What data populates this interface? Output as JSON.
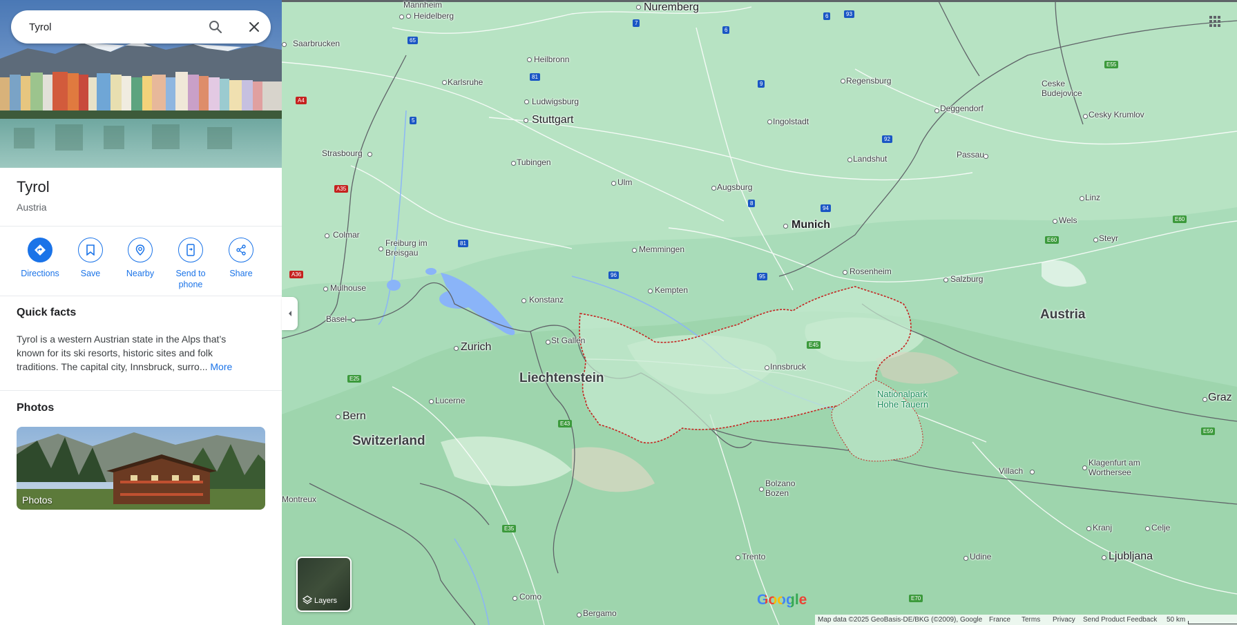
{
  "search": {
    "value": "Tyrol"
  },
  "place": {
    "title": "Tyrol",
    "subtitle": "Austria"
  },
  "actions": [
    {
      "label": "Directions",
      "icon": "directions-icon"
    },
    {
      "label": "Save",
      "icon": "bookmark-icon"
    },
    {
      "label": "Nearby",
      "icon": "nearby-icon"
    },
    {
      "label": "Send to phone",
      "icon": "send-to-phone-icon"
    },
    {
      "label": "Share",
      "icon": "share-icon"
    }
  ],
  "quick_facts": {
    "title": "Quick facts",
    "text": "Tyrol is a western Austrian state in the Alps that’s known for its ski resorts, historic sites and folk traditions. The capital city, Innsbruck, surro...",
    "more": "More"
  },
  "photos": {
    "title": "Photos",
    "card_label": "Photos"
  },
  "map": {
    "layers_label": "Layers",
    "logo": "Google",
    "countries": [
      "Liechtenstein",
      "Switzerland",
      "Austria"
    ],
    "cities": [
      "Nuremberg",
      "Heidelberg",
      "Mannheim",
      "Saarbrucken",
      "Heilbronn",
      "Karlsruhe",
      "Regensburg",
      "Ceske Budejovice",
      "Ludwigsburg",
      "Stuttgart",
      "Ingolstadt",
      "Deggendorf",
      "Cesky Krumlov",
      "Strasbourg",
      "Tubingen",
      "Landshut",
      "Passau",
      "Ulm",
      "Augsburg",
      "Linz",
      "Wels",
      "Munich",
      "Steyr",
      "Colmar",
      "Freiburg im Breisgau",
      "Memmingen",
      "Rosenheim",
      "Salzburg",
      "Mulhouse",
      "Kempten",
      "Konstanz",
      "Basel",
      "Zurich",
      "St Gallen",
      "Innsbruck",
      "Lucerne",
      "Bern",
      "Bolzano Bozen",
      "Klagenfurt am Worthersee",
      "Villach",
      "Graz",
      "Montreux",
      "Trento",
      "Kranj",
      "Celje",
      "Udine",
      "Ljubljana",
      "Como",
      "Bergamo"
    ],
    "park": "Nationalpark Hohe Tauern",
    "road_shields": [
      "65",
      "6",
      "93",
      "7",
      "6",
      "81",
      "9",
      "5",
      "92",
      "A4",
      "A35",
      "8",
      "94",
      "81",
      "96",
      "95",
      "E45",
      "E25",
      "E43",
      "E35",
      "E70",
      "E55",
      "E60",
      "E60",
      "E59",
      "A36"
    ]
  },
  "footer": {
    "map_data": "Map data ©2025 GeoBasis-DE/BKG (©2009), Google",
    "region": "France",
    "terms": "Terms",
    "privacy": "Privacy",
    "feedback": "Send Product Feedback",
    "scale": "50 km"
  },
  "colors": {
    "accent": "#1a73e8",
    "map_green": "#a8dab5",
    "water": "#8ab4f8",
    "tyrol_border": "#c5221f"
  }
}
